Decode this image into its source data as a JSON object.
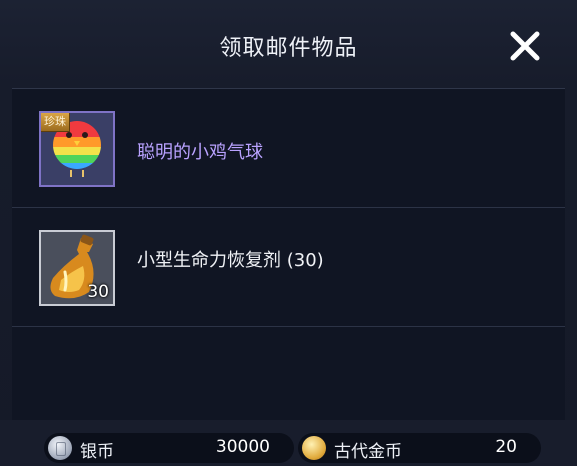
{
  "dialog": {
    "title": "领取邮件物品"
  },
  "items": [
    {
      "name": "聪明的小鸡气球",
      "tag": "珍珠",
      "rarity_color": "#b9a2ff",
      "icon": "rainbow-balloon-icon"
    },
    {
      "name": "小型生命力恢复剂 (30)",
      "quantity": "30",
      "rarity_color": "#f0f2f6",
      "icon": "potion-flask-icon"
    }
  ],
  "currency": {
    "silver": {
      "label": "银币",
      "value": "30000",
      "icon": "silver-coin-icon"
    },
    "ancient_gold": {
      "label": "古代金币",
      "value": "20",
      "icon": "gold-coin-icon"
    }
  }
}
